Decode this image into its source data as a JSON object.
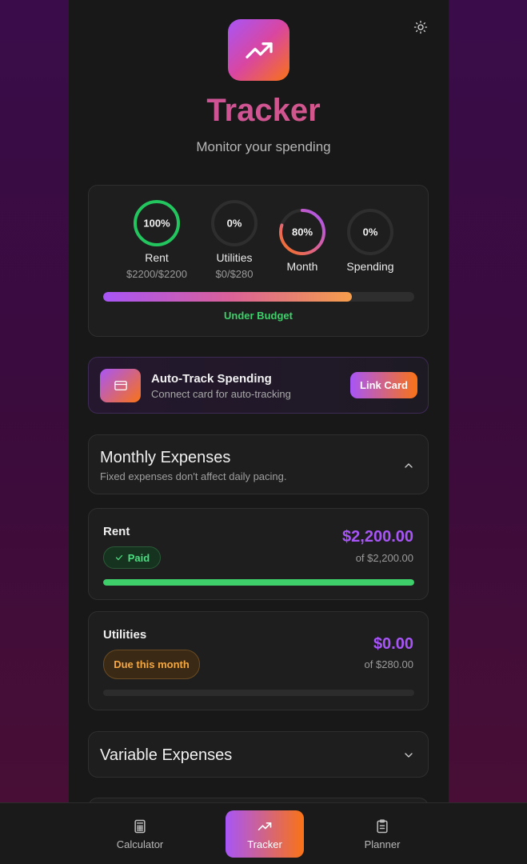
{
  "header": {
    "title": "Tracker",
    "subtitle": "Monitor your spending",
    "app_icon": "trending-up-icon",
    "theme_icon": "sun-icon"
  },
  "stats": {
    "rings": [
      {
        "pct_text": "100%",
        "label": "Rent",
        "sub": "$2200/$2200",
        "value": 1.0,
        "color": "#22c55e"
      },
      {
        "pct_text": "0%",
        "label": "Utilities",
        "sub": "$0/$280",
        "value": 0.0,
        "color": "#22c55e"
      },
      {
        "pct_text": "80%",
        "label": "Month",
        "sub": "",
        "value": 0.8,
        "color": "#c05fbf"
      },
      {
        "pct_text": "0%",
        "label": "Spending",
        "sub": "",
        "value": 0.0,
        "color": "#a855f7"
      }
    ],
    "budget_progress": 0.8,
    "budget_label": "Under Budget"
  },
  "autotrack": {
    "icon": "credit-card-icon",
    "title": "Auto-Track Spending",
    "subtitle": "Connect card for auto-tracking",
    "button": "Link Card"
  },
  "monthly": {
    "title": "Monthly Expenses",
    "subtitle": "Fixed expenses don't affect daily pacing.",
    "expanded": true,
    "items": [
      {
        "name": "Rent",
        "amount": "$2,200.00",
        "of": "of $2,200.00",
        "status": "Paid",
        "progress": 1.0
      },
      {
        "name": "Utilities",
        "amount": "$0.00",
        "of": "of $280.00",
        "status": "Due this month",
        "progress": 0.0
      }
    ]
  },
  "variable": {
    "title": "Variable Expenses",
    "expanded": false
  },
  "nav": {
    "items": [
      {
        "label": "Calculator",
        "icon": "calculator-icon",
        "active": false
      },
      {
        "label": "Tracker",
        "icon": "trending-up-icon",
        "active": true
      },
      {
        "label": "Planner",
        "icon": "clipboard-icon",
        "active": false
      }
    ]
  },
  "colors": {
    "accent_purple": "#a855f7",
    "accent_orange": "#f97316",
    "success": "#3ecf6b",
    "warning": "#f5a742"
  }
}
